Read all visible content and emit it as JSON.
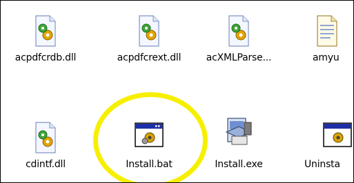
{
  "files": [
    {
      "name": "acpdfcrdb.dll",
      "icon": "dll-icon"
    },
    {
      "name": "acpdfcrext.dll",
      "icon": "dll-icon"
    },
    {
      "name": "acXMLParse...",
      "icon": "dll-icon"
    },
    {
      "name": "amyu",
      "icon": "text-file-icon"
    },
    {
      "name": "cdintf.dll",
      "icon": "dll-icon"
    },
    {
      "name": "Install.bat",
      "icon": "batch-file-icon"
    },
    {
      "name": "Install.exe",
      "icon": "setup-exe-icon"
    },
    {
      "name": "Uninsta",
      "icon": "batch-file-icon"
    }
  ],
  "highlight": {
    "target": "Install.bat",
    "color": "#f6f000"
  }
}
